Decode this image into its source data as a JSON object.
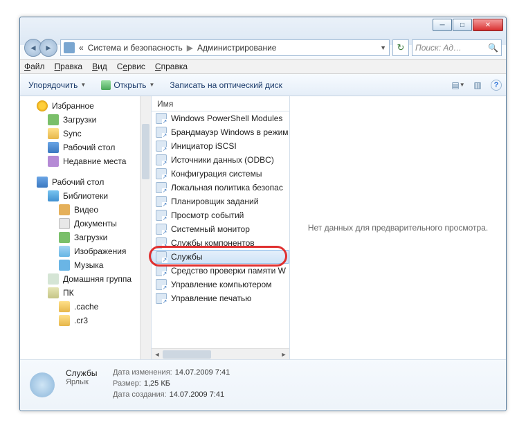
{
  "breadcrumb": {
    "parent": "Система и безопасность",
    "current": "Администрирование",
    "prefix": "«"
  },
  "search": {
    "placeholder": "Поиск: Ад…"
  },
  "menu": {
    "file": "Файл",
    "edit": "Правка",
    "view": "Вид",
    "tools": "Сервис",
    "help": "Справка"
  },
  "toolbar": {
    "organize": "Упорядочить",
    "open": "Открыть",
    "burn": "Записать на оптический диск"
  },
  "sidebar": {
    "fav": "Избранное",
    "fav_items": [
      "Загрузки",
      "Sync",
      "Рабочий стол",
      "Недавние места"
    ],
    "desktop": "Рабочий стол",
    "lib": "Библиотеки",
    "lib_items": [
      "Видео",
      "Документы",
      "Загрузки",
      "Изображения",
      "Музыка"
    ],
    "homegroup": "Домашняя группа",
    "pc": "ПК",
    "pc_items": [
      ".cache",
      ".cr3"
    ]
  },
  "list": {
    "header": "Имя",
    "items": [
      "Windows PowerShell Modules",
      "Брандмауэр Windows в режим",
      "Инициатор iSCSI",
      "Источники данных (ODBC)",
      "Конфигурация системы",
      "Локальная политика безопас",
      "Планировщик заданий",
      "Просмотр событий",
      "Системный монитор",
      "Службы компонентов",
      "Службы",
      "Средство проверки памяти W",
      "Управление компьютером",
      "Управление печатью"
    ],
    "selected_index": 10
  },
  "preview": {
    "empty": "Нет данных для предварительного просмотра."
  },
  "details": {
    "name": "Службы",
    "type": "Ярлык",
    "rows": [
      {
        "label": "Дата изменения:",
        "value": "14.07.2009 7:41"
      },
      {
        "label": "Размер:",
        "value": "1,25 КБ"
      },
      {
        "label": "Дата создания:",
        "value": "14.07.2009 7:41"
      }
    ]
  }
}
